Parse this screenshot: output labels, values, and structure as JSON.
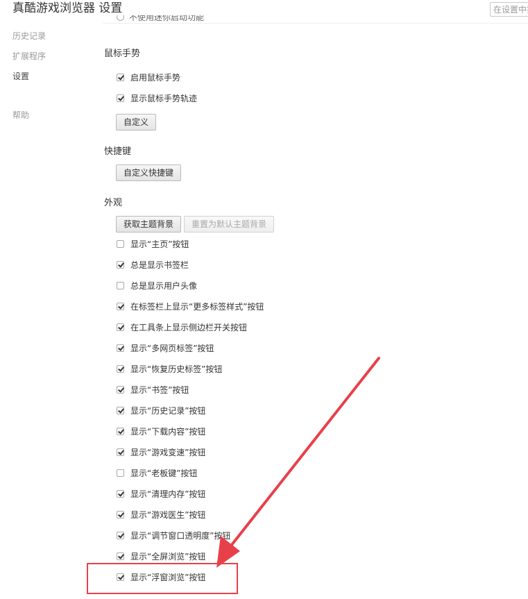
{
  "header": {
    "title": "真酷游戏浏览器 设置",
    "search_placeholder": "在设置中搜索"
  },
  "sidebar": {
    "items": [
      {
        "label": "历史记录",
        "active": false
      },
      {
        "label": "扩展程序",
        "active": false
      },
      {
        "label": "设置",
        "active": true
      },
      {
        "label": "帮助",
        "active": false
      }
    ]
  },
  "top_partial": {
    "label": "不使用迷你启动功能"
  },
  "mouse_gesture": {
    "title": "鼠标手势",
    "options": [
      {
        "label": "启用鼠标手势",
        "checked": true
      },
      {
        "label": "显示鼠标手势轨迹",
        "checked": true
      }
    ],
    "customize_button": "自定义"
  },
  "shortcuts": {
    "title": "快捷键",
    "customize_button": "自定义快捷键"
  },
  "appearance": {
    "title": "外观",
    "get_theme_button": "获取主题背景",
    "reset_theme_button": "重置为默认主题背景",
    "options": [
      {
        "label": "显示“主页”按钮",
        "checked": false
      },
      {
        "label": "总是显示书签栏",
        "checked": true
      },
      {
        "label": "总是显示用户头像",
        "checked": false
      },
      {
        "label": "在标签栏上显示“更多标签样式”按钮",
        "checked": true
      },
      {
        "label": "在工具条上显示侧边栏开关按钮",
        "checked": true
      },
      {
        "label": "显示“多网页标签”按钮",
        "checked": true
      },
      {
        "label": "显示“恢复历史标签”按钮",
        "checked": true
      },
      {
        "label": "显示“书签”按钮",
        "checked": true
      },
      {
        "label": "显示“历史记录”按钮",
        "checked": true
      },
      {
        "label": "显示“下载内容”按钮",
        "checked": true
      },
      {
        "label": "显示“游戏变速”按钮",
        "checked": true
      },
      {
        "label": "显示“老板键”按钮",
        "checked": false
      },
      {
        "label": "显示“清理内存”按钮",
        "checked": true
      },
      {
        "label": "显示“游戏医生”按钮",
        "checked": true
      },
      {
        "label": "显示“调节窗口透明度”按钮",
        "checked": true
      },
      {
        "label": "显示“全屏浏览”按钮",
        "checked": true
      },
      {
        "label": "显示“浮窗浏览”按钮",
        "checked": true
      }
    ]
  },
  "annotation": {
    "color": "#e8404a"
  }
}
